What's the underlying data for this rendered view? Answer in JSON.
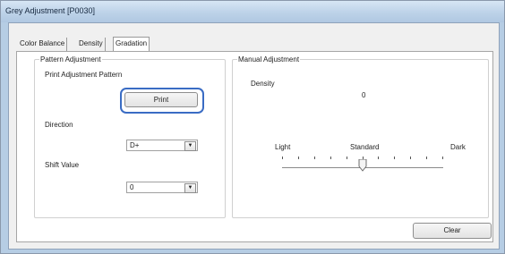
{
  "window": {
    "title": "Grey Adjustment [P0030]"
  },
  "tabs": [
    {
      "label": "Color Balance",
      "active": false
    },
    {
      "label": "Density",
      "active": true
    },
    {
      "label": "Gradation",
      "active": false
    }
  ],
  "pattern": {
    "legend": "Pattern Adjustment",
    "print_label": "Print Adjustment Pattern",
    "print_button": "Print",
    "direction_label": "Direction",
    "direction_value": "D+",
    "shift_label": "Shift Value",
    "shift_value": "0"
  },
  "manual": {
    "legend": "Manual Adjustment",
    "density_label": "Density",
    "density_value": "0",
    "slider_light": "Light",
    "slider_standard": "Standard",
    "slider_dark": "Dark",
    "slider_position": 0.5
  },
  "footer": {
    "clear_button": "Clear"
  },
  "colors": {
    "highlight": "#3a6cc4"
  },
  "icons": {
    "combo_arrow": "chevron-down-icon"
  }
}
